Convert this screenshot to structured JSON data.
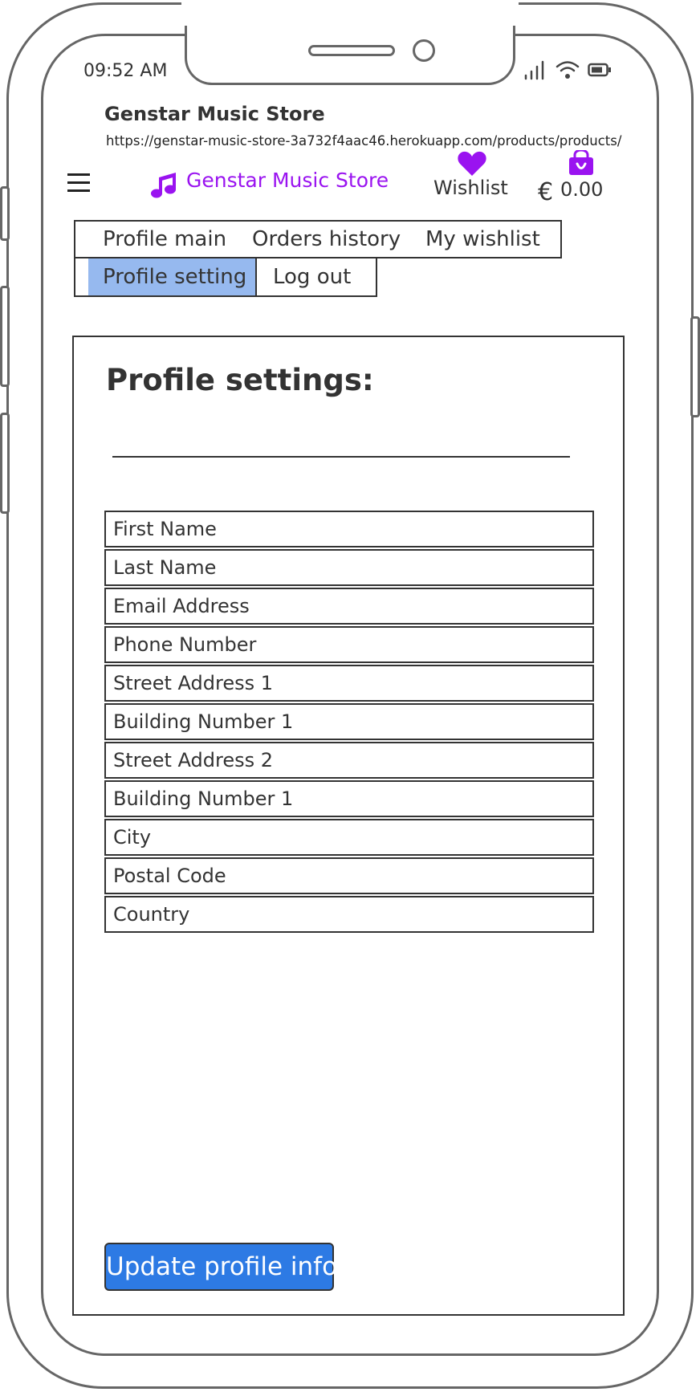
{
  "status_bar": {
    "time": "09:52 AM"
  },
  "browser": {
    "title": "Genstar Music Store",
    "url": "https://genstar-music-store-3a732f4aac46.herokuapp.com/products/products/"
  },
  "header": {
    "brand": "Genstar Music Store",
    "wishlist_label": "Wishlist",
    "currency_symbol": "€",
    "cart_total": "0.00",
    "accent_color": "#9a13f0",
    "icons": {
      "menu": "hamburger-icon",
      "logo": "music-note-icon",
      "wishlist": "heart-icon",
      "cart": "shopping-bag-icon"
    }
  },
  "profile_tabs": {
    "profile_main": "Profile main",
    "orders_history": "Orders history",
    "my_wishlist": "My wishlist",
    "profile_setting": "Profile setting",
    "log_out": "Log out",
    "active": "Profile setting",
    "active_color": "#96b9ef"
  },
  "settings": {
    "title": "Profile settings:",
    "fields": [
      {
        "placeholder": "First Name",
        "value": ""
      },
      {
        "placeholder": "Last Name",
        "value": ""
      },
      {
        "placeholder": "Email Address",
        "value": ""
      },
      {
        "placeholder": "Phone Number",
        "value": ""
      },
      {
        "placeholder": "Street Address 1",
        "value": ""
      },
      {
        "placeholder": "Building Number 1",
        "value": ""
      },
      {
        "placeholder": "Street Address 2",
        "value": ""
      },
      {
        "placeholder": "Building Number 1",
        "value": ""
      },
      {
        "placeholder": "City",
        "value": ""
      },
      {
        "placeholder": "Postal Code",
        "value": ""
      },
      {
        "placeholder": "Country",
        "value": ""
      }
    ],
    "submit_label": "Update profile info",
    "submit_color": "#2d7ae4"
  }
}
